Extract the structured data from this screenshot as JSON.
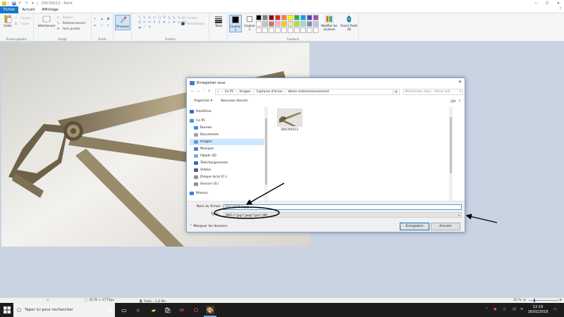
{
  "window": {
    "title": "DSC00212 - Paint"
  },
  "menu": {
    "tabs": [
      "Fichier",
      "Accueil",
      "Affichage"
    ]
  },
  "ribbon": {
    "clipboard": {
      "paste": "Coller",
      "cut": "Couper",
      "copy": "Copier",
      "group": "Presse-papiers"
    },
    "image": {
      "select": "Sélectionner",
      "crop": "Rogner",
      "resize": "Redimensionner",
      "rotate": "Faire pivoter",
      "group": "Image"
    },
    "tools": {
      "group": "Outils"
    },
    "brushes": {
      "label": "Pinceaux"
    },
    "shapes": {
      "outline": "Contour",
      "fill": "Remplissage",
      "group": "Formes"
    },
    "size": {
      "label": "Taille"
    },
    "color1": {
      "label": "Couleur",
      "num": "1"
    },
    "color2": {
      "label": "Couleur",
      "num": "2"
    },
    "editcolors": {
      "label": "Modifier les couleurs"
    },
    "paint3d": {
      "label": "Ouvrir Paint 3D"
    },
    "colors_group": "Couleurs",
    "palette": [
      "#000000",
      "#7f7f7f",
      "#880015",
      "#ed1c24",
      "#ff7f27",
      "#fff200",
      "#22b14c",
      "#00a2e8",
      "#3f48cc",
      "#a349a4",
      "#ffffff",
      "#c3c3c3",
      "#b97a57",
      "#ffaec9",
      "#ffc90e",
      "#efe4b0",
      "#b5e61d",
      "#99d9ea",
      "#7092be",
      "#c8bfe7",
      "#ffffff",
      "#ffffff",
      "#ffffff",
      "#ffffff",
      "#ffffff",
      "#ffffff",
      "#ffffff",
      "#ffffff",
      "#ffffff",
      "#ffffff"
    ]
  },
  "dialog": {
    "title": "Enregistrer sous",
    "path": [
      "Ce PC",
      "Images",
      "Captures d'écran",
      "démo redimensionnement"
    ],
    "search_placeholder": "Rechercher dans : démo redi...",
    "organize": "Organiser ▾",
    "new_folder": "Nouveau dossier",
    "nav_items": [
      "OneDrive",
      "Ce PC",
      "Bureau",
      "Documents",
      "Images",
      "Musique",
      "Objets 3D",
      "Téléchargements",
      "Vidéos",
      "Disque local (C:)",
      "Service (S:)",
      "Réseau"
    ],
    "file": {
      "name": "DSC00212"
    },
    "filename_label": "Nom du fichier :",
    "filename_value": "DSC00212.jpg",
    "filetype_label": "Type :",
    "filetype_value": "JPEG (*.jpg;*.jpeg;*.jpe;*.jfif)",
    "hide_folders": "Masquer les dossiers",
    "save": "Enregistrer",
    "cancel": "Annuler"
  },
  "status": {
    "dimensions": "4176 × 2775px",
    "size": "Taille : 2,8 Mo",
    "zoom": "25 %"
  },
  "taskbar": {
    "search_placeholder": "Taper ici pour rechercher",
    "time": "12:19",
    "date": "16/02/2018"
  }
}
